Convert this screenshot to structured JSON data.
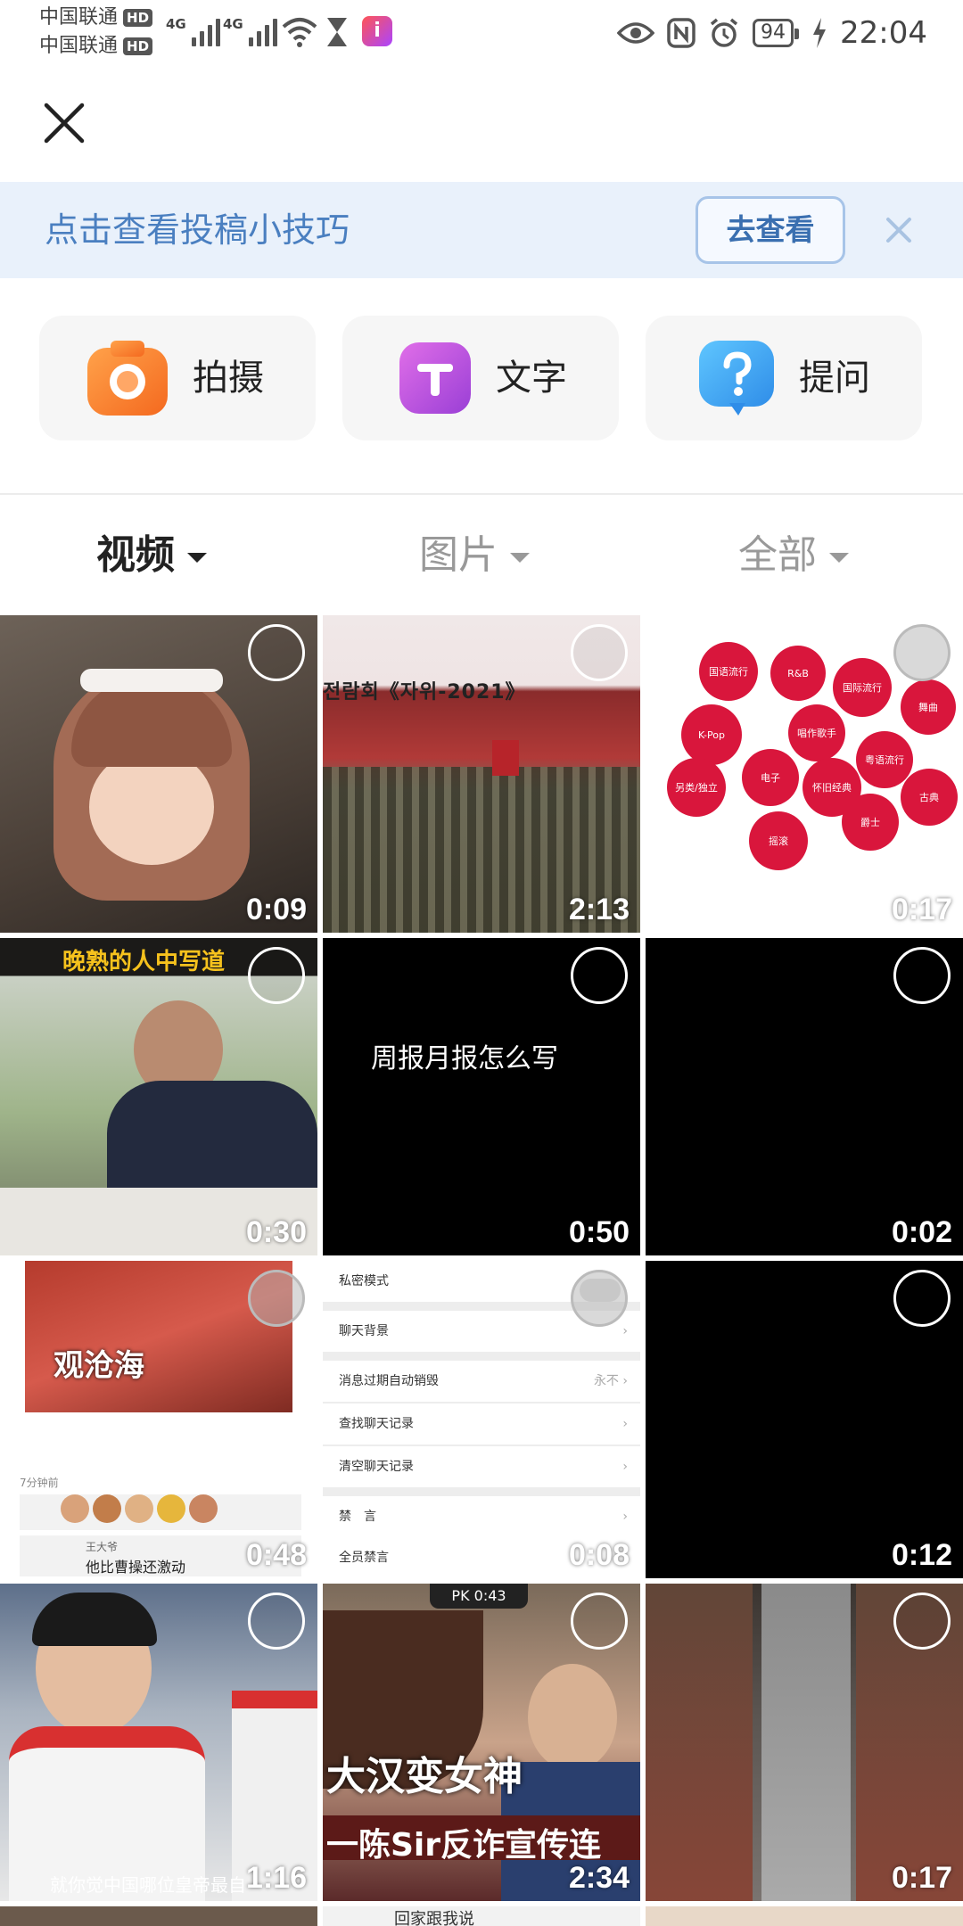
{
  "status": {
    "carrier1": "中国联通",
    "carrier2": "中国联通",
    "hd": "HD",
    "net1": "4G",
    "net2": "4G",
    "battery": "94",
    "time": "22:04"
  },
  "tips": {
    "text": "点击查看投稿小技巧",
    "button": "去查看"
  },
  "actions": [
    {
      "label": "拍摄",
      "icon": "camera-icon",
      "color": "#f8822e"
    },
    {
      "label": "文字",
      "icon": "text-icon",
      "color": "#c44fdc"
    },
    {
      "label": "提问",
      "icon": "question-icon",
      "color": "#3ea2f0"
    }
  ],
  "filters": [
    {
      "label": "视频",
      "active": true
    },
    {
      "label": "图片",
      "active": false
    },
    {
      "label": "全部",
      "active": false
    }
  ],
  "media": [
    {
      "duration": "0:09",
      "overlay": ""
    },
    {
      "duration": "2:13",
      "overlay": "전람회《자위-2021》"
    },
    {
      "duration": "0:17",
      "overlay": ""
    },
    {
      "duration": "0:30",
      "overlay": "晚熟的人中写道"
    },
    {
      "duration": "0:50",
      "overlay": "周报月报怎么写"
    },
    {
      "duration": "0:02",
      "overlay": ""
    },
    {
      "duration": "0:48",
      "overlay": "观沧海"
    },
    {
      "duration": "0:08",
      "overlay": ""
    },
    {
      "duration": "0:12",
      "overlay": ""
    },
    {
      "duration": "1:16",
      "overlay": "就你觉中国哪位皇帝最自"
    },
    {
      "duration": "2:34",
      "overlay": "大汉变女神"
    },
    {
      "duration": "0:17",
      "overlay": ""
    }
  ],
  "music_bubbles": [
    "国语流行",
    "R&B",
    "国际流行",
    "舞曲",
    "K-Pop",
    "唱作歌手",
    "粤语流行",
    "另类/独立",
    "电子",
    "怀旧经典",
    "古典",
    "爵士",
    "摇滚"
  ],
  "chat_settings": {
    "rows": [
      "私密模式",
      "聊天背景",
      "消息过期自动销毁",
      "查找聊天记录",
      "清空聊天记录",
      "禁　言",
      "全员禁言"
    ],
    "expire_value": "永不"
  },
  "comment_snippet": {
    "time": "7分钟前",
    "user": "王大爷",
    "text": "他比曹操还激动"
  },
  "pk_badge": "PK 0:43",
  "police_caption": "一陈Sir反诈宣传连",
  "letter_heading": "回家跟我说"
}
